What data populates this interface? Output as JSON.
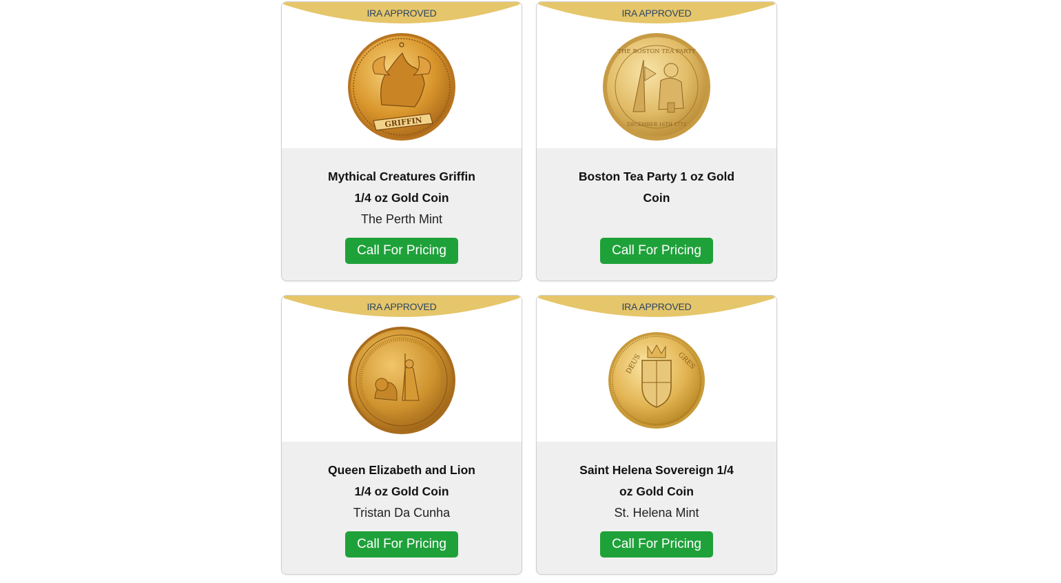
{
  "products": [
    {
      "badge": "IRA APPROVED",
      "title": "Mythical Creatures Griffin 1/4 oz Gold Coin",
      "mint": "The Perth Mint",
      "button": "Call For Pricing",
      "image": "griffin-gold-coin"
    },
    {
      "badge": "IRA APPROVED",
      "title": "Boston Tea Party 1 oz Gold Coin",
      "mint": "",
      "button": "Call For Pricing",
      "image": "boston-tea-party-gold-coin"
    },
    {
      "badge": "IRA APPROVED",
      "title": "Queen Elizabeth and Lion 1/4 oz Gold Coin",
      "mint": "Tristan Da Cunha",
      "button": "Call For Pricing",
      "image": "queen-elizabeth-lion-gold-coin"
    },
    {
      "badge": "IRA APPROVED",
      "title": "Saint Helena Sovereign 1/4 oz Gold Coin",
      "mint": "St. Helena Mint",
      "button": "Call For Pricing",
      "image": "saint-helena-sovereign-gold-coin"
    }
  ],
  "colors": {
    "badge_gold": "#e6c66a",
    "badge_text": "#2b4462",
    "button_green": "#1fa13a",
    "card_bg": "#efefef"
  }
}
